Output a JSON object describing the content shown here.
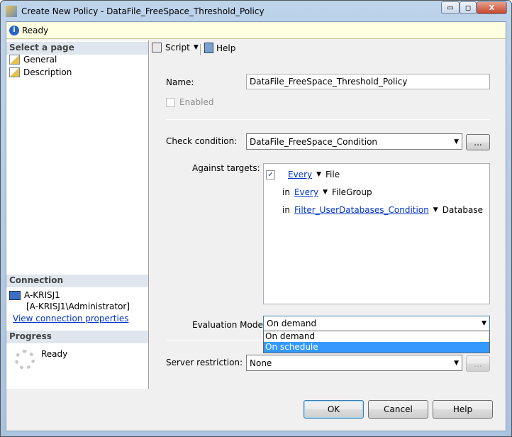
{
  "window": {
    "title": "Create New Policy - DataFile_FreeSpace_Threshold_Policy",
    "minimize": "▭",
    "maximize": "◻",
    "close": "X"
  },
  "status": {
    "text": "Ready"
  },
  "sidebar": {
    "select_header": "Select a page",
    "pages": [
      {
        "label": "General"
      },
      {
        "label": "Description"
      }
    ],
    "connection_header": "Connection",
    "server": "A-KRISJ1",
    "user": "[A-KRISJ1\\Administrator]",
    "view_link": "View connection properties",
    "progress_header": "Progress",
    "progress_status": "Ready"
  },
  "toolbar": {
    "script": "Script",
    "help": "Help"
  },
  "form": {
    "name_label": "Name:",
    "name_value": "DataFile_FreeSpace_Threshold_Policy",
    "enabled_label": "Enabled",
    "check_condition_label": "Check condition:",
    "check_condition_value": "DataFile_FreeSpace_Condition",
    "ellipsis": "...",
    "against_targets_label": "Against targets:",
    "targets": [
      {
        "prefix": "",
        "link": "Every",
        "target": "File"
      },
      {
        "prefix": "in",
        "link": "Every",
        "target": "FileGroup"
      },
      {
        "prefix": "in",
        "link": "Filter_UserDatabases_Condition",
        "target": "Database"
      }
    ],
    "evaluation_mode_label": "Evaluation Mode:",
    "evaluation_mode_value": "On demand",
    "evaluation_options": [
      "On demand",
      "On schedule"
    ],
    "server_restriction_label": "Server restriction:",
    "server_restriction_value": "None"
  },
  "buttons": {
    "ok": "OK",
    "cancel": "Cancel",
    "help": "Help"
  }
}
